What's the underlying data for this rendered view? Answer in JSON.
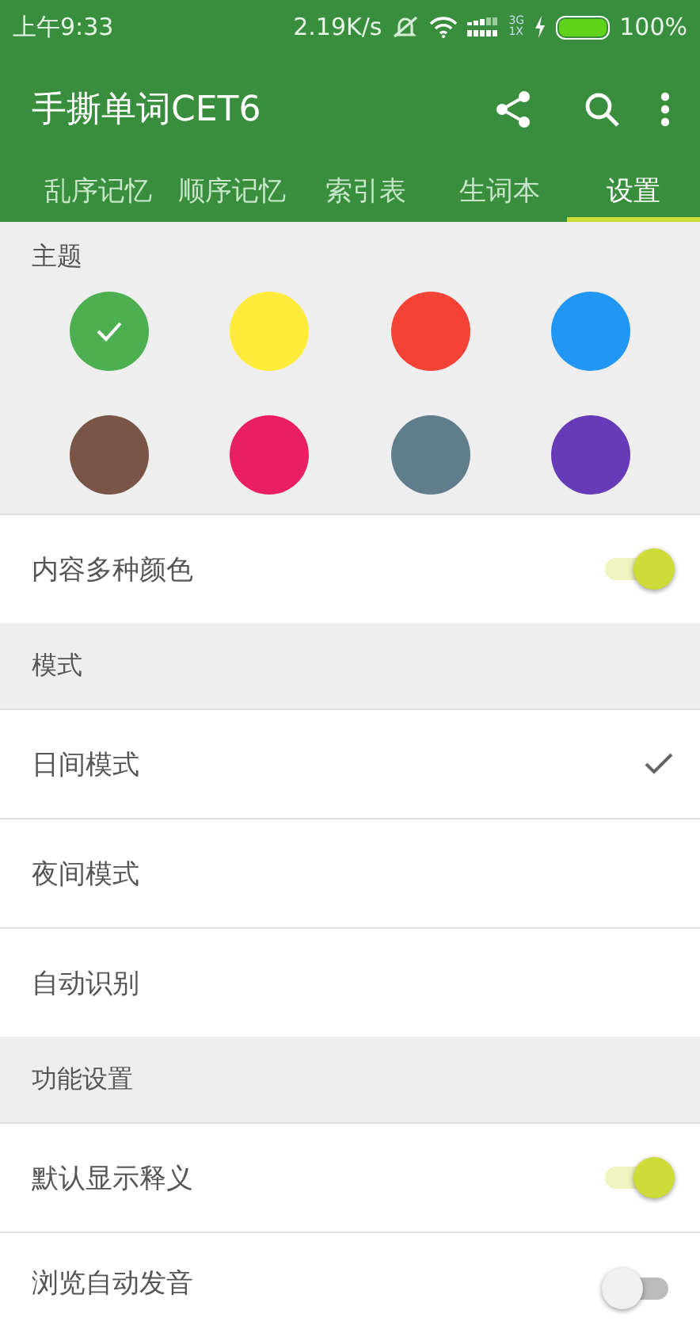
{
  "status_bar": {
    "time": "上午9:33",
    "speed": "2.19K/s",
    "network": "3G",
    "network_sub": "1X",
    "battery": "100%"
  },
  "app_bar": {
    "title": "手撕单词CET6"
  },
  "tabs": [
    {
      "label": "乱序记忆",
      "selected": false
    },
    {
      "label": "顺序记忆",
      "selected": false
    },
    {
      "label": "索引表",
      "selected": false
    },
    {
      "label": "生词本",
      "selected": false
    },
    {
      "label": "设置",
      "selected": true
    }
  ],
  "theme": {
    "header": "主题",
    "colors": [
      {
        "color": "#4caf50",
        "selected": true
      },
      {
        "color": "#ffeb3b",
        "selected": false
      },
      {
        "color": "#f44336",
        "selected": false
      },
      {
        "color": "#2196f3",
        "selected": false
      },
      {
        "color": "#795548",
        "selected": false
      },
      {
        "color": "#e91e63",
        "selected": false
      },
      {
        "color": "#607d8b",
        "selected": false
      },
      {
        "color": "#673ab7",
        "selected": false
      }
    ]
  },
  "multi_color": {
    "label": "内容多种颜色",
    "on": true
  },
  "mode": {
    "header": "模式",
    "options": [
      {
        "label": "日间模式",
        "selected": true
      },
      {
        "label": "夜间模式",
        "selected": false
      },
      {
        "label": "自动识别",
        "selected": false
      }
    ]
  },
  "features": {
    "header": "功能设置",
    "items": [
      {
        "label": "默认显示释义",
        "on": true
      },
      {
        "label": "浏览自动发音",
        "on": false
      }
    ]
  }
}
